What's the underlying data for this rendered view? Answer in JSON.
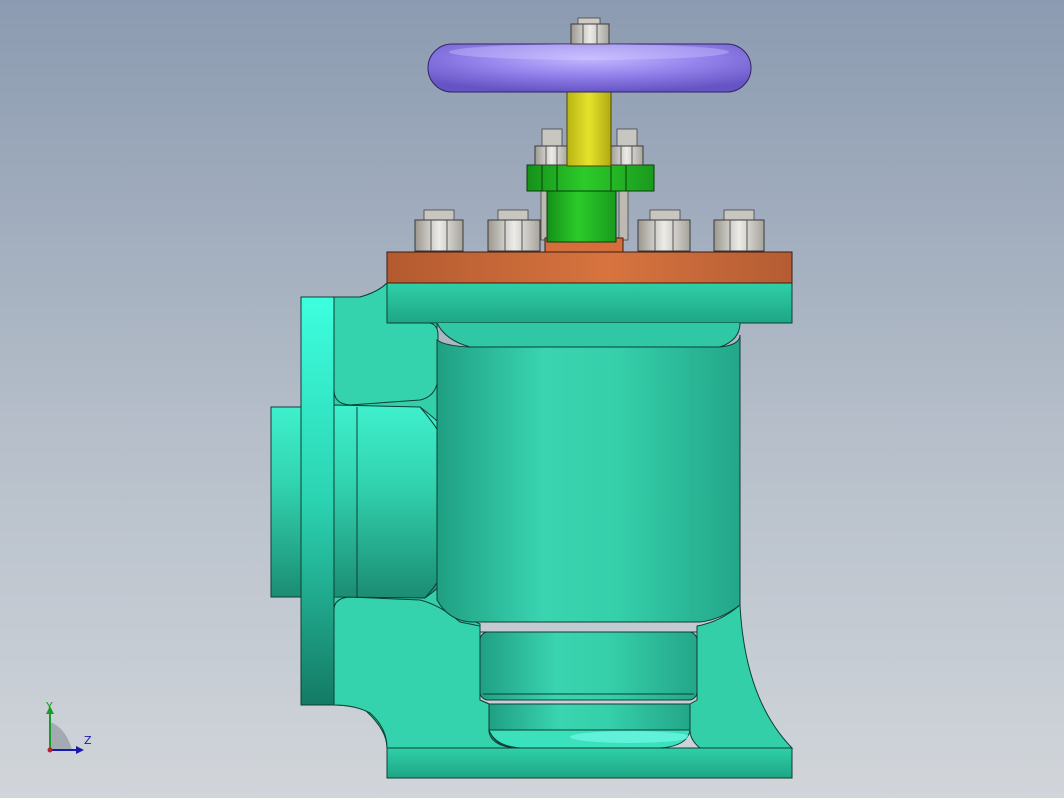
{
  "viewport": {
    "triad": {
      "y_label": "Y",
      "z_label": "Z"
    }
  },
  "colors": {
    "body": "#33cfa9",
    "body_dark": "#15806a",
    "body_light": "#3ffadb",
    "bonnet_flange": "#c4673a",
    "handwheel": "#8f7ee6",
    "stem": "#d7d21c",
    "gland": "#22b521",
    "bolt": "#d9d6d0"
  }
}
